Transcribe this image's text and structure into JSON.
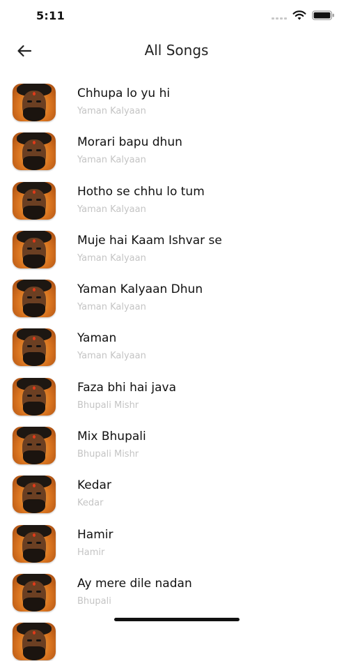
{
  "status_bar": {
    "time": "5:11"
  },
  "header": {
    "title": "All Songs"
  },
  "songs": [
    {
      "title": "Chhupa lo yu hi",
      "artist": "Yaman Kalyaan"
    },
    {
      "title": "Morari bapu dhun",
      "artist": "Yaman Kalyaan"
    },
    {
      "title": "Hotho se chhu lo tum",
      "artist": "Yaman Kalyaan"
    },
    {
      "title": "Muje hai Kaam Ishvar se",
      "artist": "Yaman Kalyaan"
    },
    {
      "title": "Yaman Kalyaan Dhun",
      "artist": "Yaman Kalyaan"
    },
    {
      "title": "Yaman",
      "artist": "Yaman Kalyaan"
    },
    {
      "title": "Faza bhi hai java",
      "artist": "Bhupali Mishr"
    },
    {
      "title": "Mix Bhupali",
      "artist": "Bhupali Mishr"
    },
    {
      "title": "Kedar",
      "artist": "Kedar"
    },
    {
      "title": "Hamir",
      "artist": "Hamir"
    },
    {
      "title": "Ay mere dile nadan",
      "artist": "Bhupali"
    },
    {
      "title": "",
      "artist": ""
    }
  ]
}
